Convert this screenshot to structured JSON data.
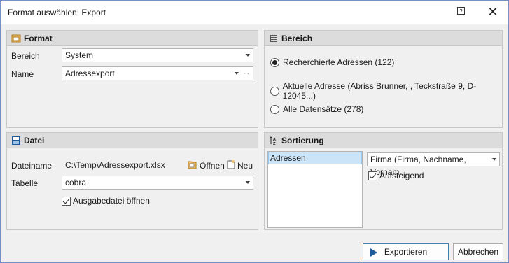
{
  "window": {
    "title": "Format auswählen: Export",
    "help_label": "?",
    "close_label": "✕"
  },
  "format_panel": {
    "header": "Format",
    "bereich_label": "Bereich",
    "bereich_value": "System",
    "name_label": "Name",
    "name_value": "Adressexport",
    "ellipsis": "···"
  },
  "bereich_panel": {
    "header": "Bereich",
    "options": [
      {
        "label": "Recherchierte Adressen (122)",
        "selected": true
      },
      {
        "label": "Aktuelle Adresse (Abriss Brunner, , Teckstraße 9, D-12045...)",
        "selected": false
      },
      {
        "label": "Alle Datensätze (278)",
        "selected": false
      }
    ]
  },
  "datei_panel": {
    "header": "Datei",
    "dateiname_label": "Dateiname",
    "dateiname_value": "C:\\Temp\\Adressexport.xlsx",
    "open_label": "Öffnen",
    "new_label": "Neu",
    "tabelle_label": "Tabelle",
    "tabelle_value": "cobra",
    "open_after_label": "Ausgabedatei öffnen",
    "open_after_checked": true
  },
  "sortierung_panel": {
    "header": "Sortierung",
    "list_items": [
      "Adressen"
    ],
    "sort_value": "Firma (Firma, Nachname, Vornam...",
    "ascending_label": "Aufsteigend",
    "ascending_checked": true
  },
  "footer": {
    "export_label": "Exportieren",
    "cancel_label": "Abbrechen"
  },
  "colors": {
    "accent": "#1e5a99",
    "selection": "#cce4f7",
    "window_border": "#6f93c4"
  }
}
